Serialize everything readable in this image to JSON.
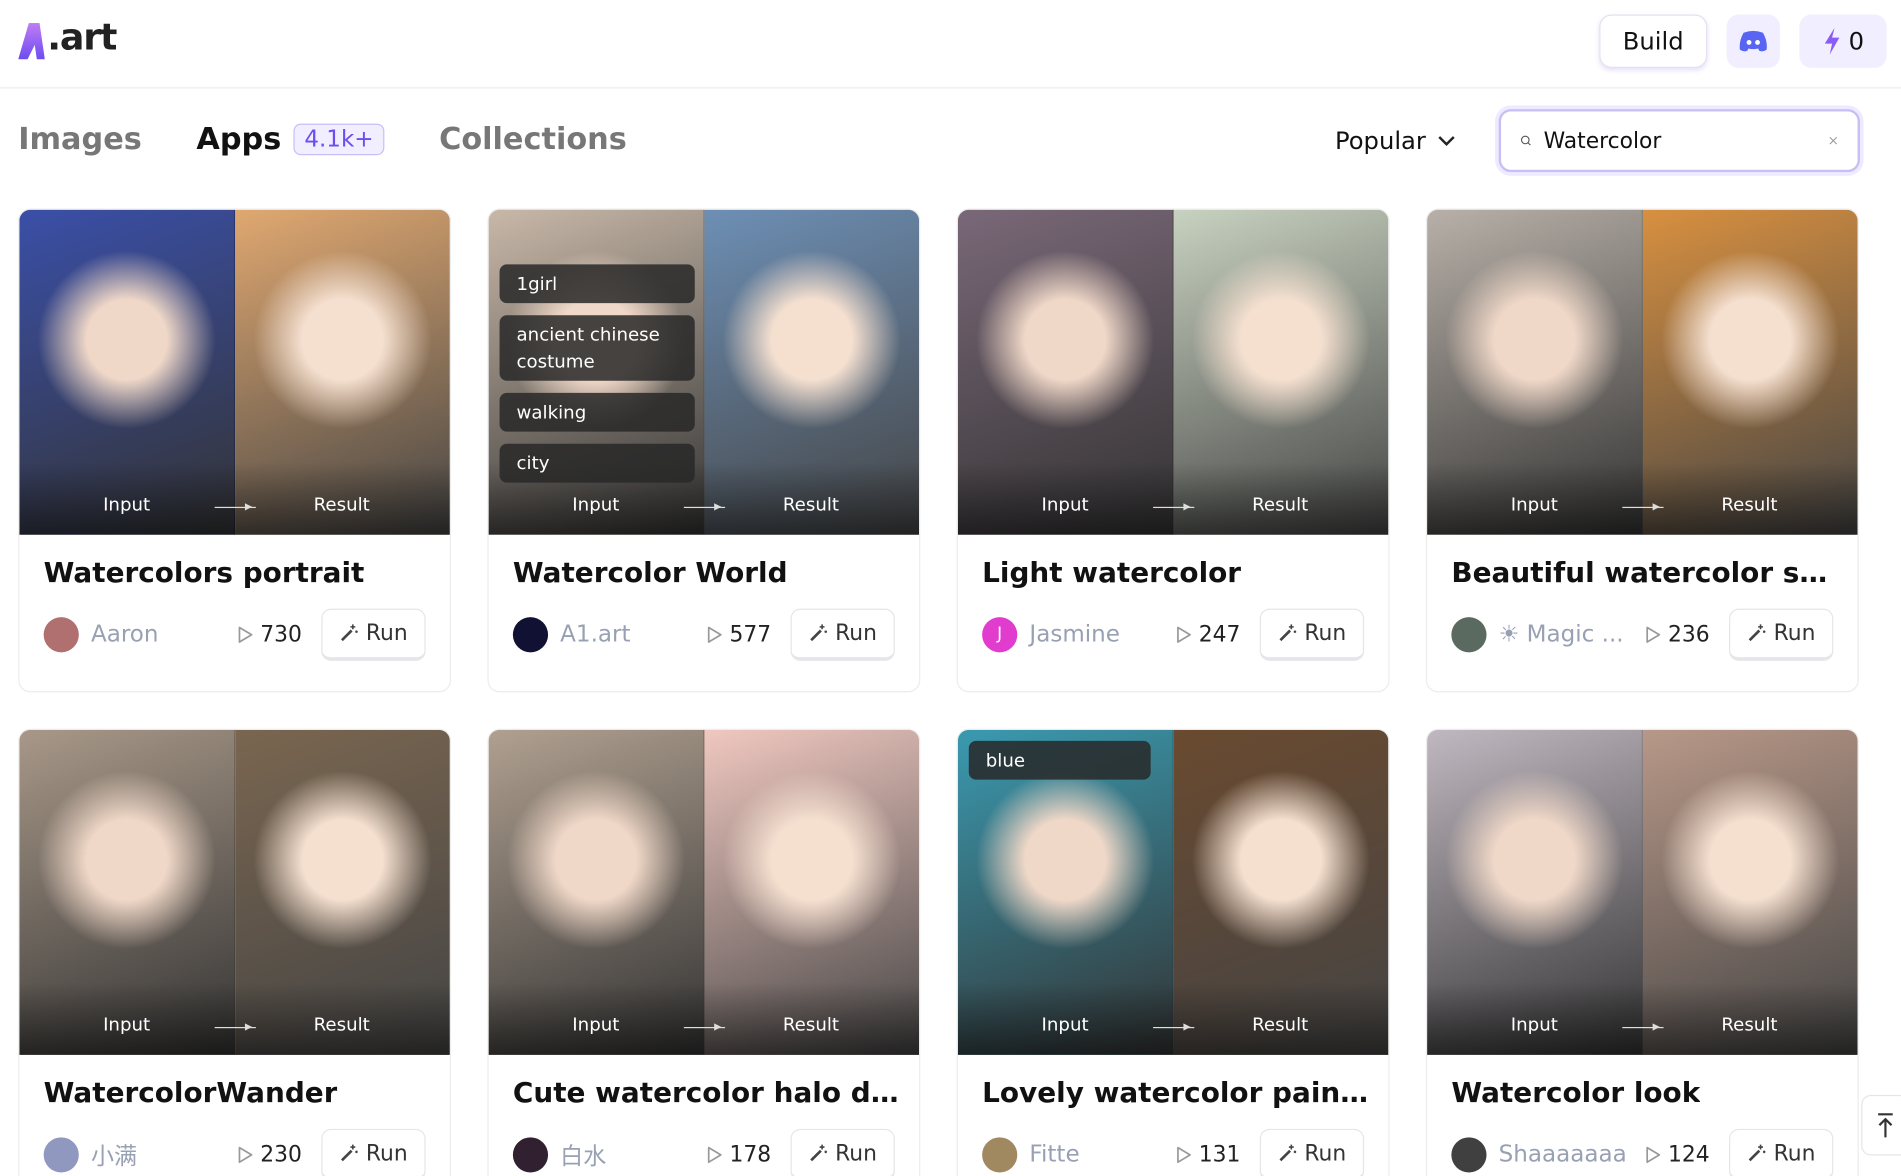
{
  "header": {
    "logo_text": ".art",
    "build_label": "Build",
    "discord_icon": "discord-icon",
    "credits": "0",
    "accent": "#6d4cf0"
  },
  "tabs": [
    {
      "label": "Images"
    },
    {
      "label": "Apps",
      "badge": "4.1k+"
    },
    {
      "label": "Collections"
    }
  ],
  "sort": {
    "selected": "Popular"
  },
  "search": {
    "value": "Watercolor"
  },
  "card_labels": {
    "input": "Input",
    "result": "Result",
    "run": "Run"
  },
  "cards": [
    {
      "title": "Watercolors portrait",
      "author": "Aaron",
      "runs": "730",
      "chips": [],
      "colors": [
        "#3a4fa8",
        "#e0a870"
      ],
      "avatar": "#b07070"
    },
    {
      "title": "Watercolor World",
      "author": "A1.art",
      "runs": "577",
      "chips": [
        "1girl",
        "ancient chinese costume",
        "walking",
        "city"
      ],
      "colors": [
        "#c8b8a8",
        "#6d8fb5"
      ],
      "avatar": "#111133"
    },
    {
      "title": "Light watercolor",
      "author": "Jasmine",
      "runs": "247",
      "chips": [],
      "colors": [
        "#7a6878",
        "#c8d2c0"
      ],
      "avatar": "#e23ccf",
      "avatar_letter": "J"
    },
    {
      "title": "Beautiful watercolor style",
      "author": "☀ Magic ...",
      "runs": "236",
      "chips": [],
      "colors": [
        "#b8b0a8",
        "#d89040"
      ],
      "avatar": "#5a6a60"
    },
    {
      "title": "WatercolorWander",
      "author": "小满",
      "runs": "230",
      "chips": [],
      "colors": [
        "#a89888",
        "#7a6650"
      ],
      "avatar": "#9098c0"
    },
    {
      "title": "Cute watercolor halo dyei...",
      "author": "白水",
      "runs": "178",
      "chips": [],
      "colors": [
        "#b0a090",
        "#f0c8c0"
      ],
      "avatar": "#302030"
    },
    {
      "title": "Lovely watercolor painting",
      "author": "Fitte",
      "runs": "131",
      "chips": [
        "blue"
      ],
      "colors": [
        "#3a9ab0",
        "#6a4a30"
      ],
      "avatar": "#a08860"
    },
    {
      "title": "Watercolor look",
      "author": "Shaaaaaaa",
      "runs": "124",
      "chips": [],
      "colors": [
        "#c0b8c0",
        "#b89888"
      ],
      "avatar": "#404040"
    }
  ]
}
